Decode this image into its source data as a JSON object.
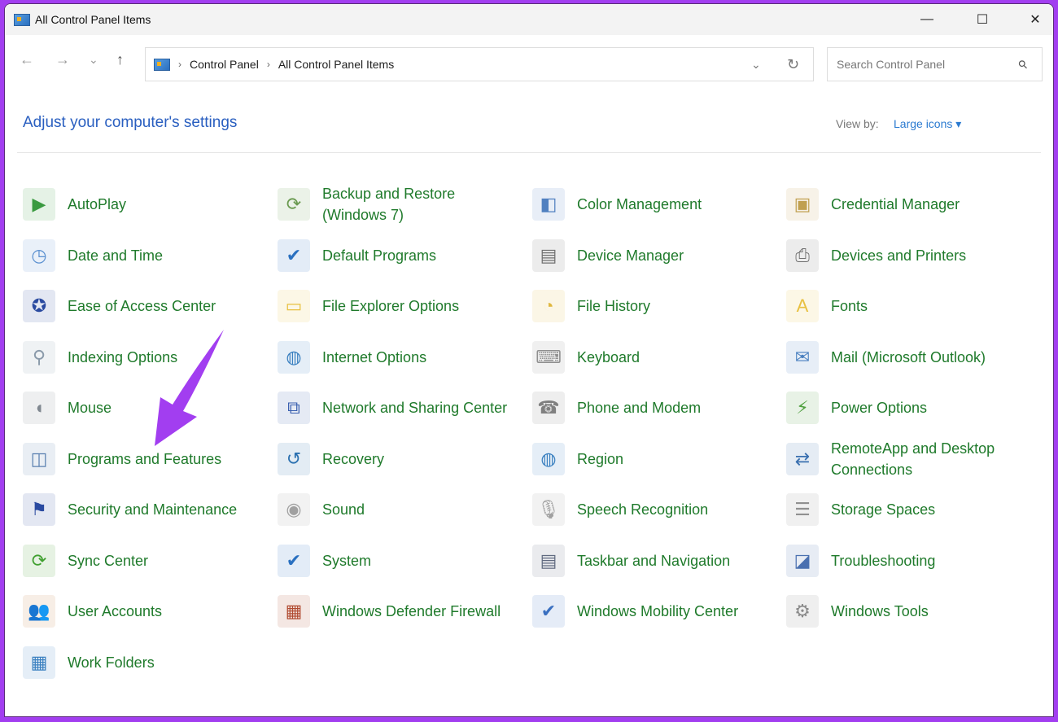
{
  "window": {
    "title": "All Control Panel Items",
    "minimize": "—",
    "maximize": "☐",
    "close": "✕"
  },
  "nav": {
    "back": "←",
    "forward": "→",
    "recent": "⌄",
    "up": "↑"
  },
  "address": {
    "crumbs": [
      "Control Panel",
      "All Control Panel Items"
    ],
    "separator": "›",
    "dropdown": "⌄",
    "refresh": "↻"
  },
  "search": {
    "placeholder": "Search Control Panel",
    "icon": "⚲"
  },
  "heading": "Adjust your computer's settings",
  "view_by": {
    "label": "View by:",
    "value": "Large icons ▾"
  },
  "accent": {
    "link": "#1f7a2b",
    "heading": "#2a5fc0",
    "annotation_arrow": "#a23ef0"
  },
  "items": [
    {
      "label": "AutoPlay",
      "icon": "autoplay-icon",
      "g": "▶",
      "c": "#3a9a40"
    },
    {
      "label": "Backup and Restore (Windows 7)",
      "icon": "backup-icon",
      "g": "⟳",
      "c": "#6a9a50"
    },
    {
      "label": "Color Management",
      "icon": "color-management-icon",
      "g": "◧",
      "c": "#5080c0"
    },
    {
      "label": "Credential Manager",
      "icon": "credential-icon",
      "g": "▣",
      "c": "#c0a050"
    },
    {
      "label": "Date and Time",
      "icon": "clock-icon",
      "g": "◷",
      "c": "#5a90d0"
    },
    {
      "label": "Default Programs",
      "icon": "default-programs-icon",
      "g": "✔",
      "c": "#2a70c0"
    },
    {
      "label": "Device Manager",
      "icon": "device-manager-icon",
      "g": "▤",
      "c": "#707070"
    },
    {
      "label": "Devices and Printers",
      "icon": "printer-icon",
      "g": "⎙",
      "c": "#707070"
    },
    {
      "label": "Ease of Access Center",
      "icon": "ease-of-access-icon",
      "g": "✪",
      "c": "#2a4aa0"
    },
    {
      "label": "File Explorer Options",
      "icon": "folder-options-icon",
      "g": "▭",
      "c": "#e8c040"
    },
    {
      "label": "File History",
      "icon": "file-history-icon",
      "g": "◔",
      "c": "#e0b840"
    },
    {
      "label": "Fonts",
      "icon": "fonts-icon",
      "g": "A",
      "c": "#e8c040"
    },
    {
      "label": "Indexing Options",
      "icon": "indexing-icon",
      "g": "⚲",
      "c": "#8a9aaa"
    },
    {
      "label": "Internet Options",
      "icon": "internet-icon",
      "g": "◍",
      "c": "#3a80c0"
    },
    {
      "label": "Keyboard",
      "icon": "keyboard-icon",
      "g": "⌨",
      "c": "#909090"
    },
    {
      "label": "Mail (Microsoft Outlook)",
      "icon": "mail-icon",
      "g": "✉",
      "c": "#4a80c0"
    },
    {
      "label": "Mouse",
      "icon": "mouse-icon",
      "g": "◖",
      "c": "#808890"
    },
    {
      "label": "Network and Sharing Center",
      "icon": "network-icon",
      "g": "⧉",
      "c": "#3a60b0"
    },
    {
      "label": "Phone and Modem",
      "icon": "phone-icon",
      "g": "☎",
      "c": "#808080"
    },
    {
      "label": "Power Options",
      "icon": "power-icon",
      "g": "⚡",
      "c": "#50a040"
    },
    {
      "label": "Programs and Features",
      "icon": "programs-icon",
      "g": "◫",
      "c": "#5a80b0"
    },
    {
      "label": "Recovery",
      "icon": "recovery-icon",
      "g": "↺",
      "c": "#2a70b0"
    },
    {
      "label": "Region",
      "icon": "region-icon",
      "g": "◍",
      "c": "#3a80c0"
    },
    {
      "label": "RemoteApp and Desktop Connections",
      "icon": "remoteapp-icon",
      "g": "⇄",
      "c": "#3a70b0"
    },
    {
      "label": "Security and Maintenance",
      "icon": "flag-icon",
      "g": "⚑",
      "c": "#2a4aa0"
    },
    {
      "label": "Sound",
      "icon": "speaker-icon",
      "g": "◉",
      "c": "#a0a0a0"
    },
    {
      "label": "Speech Recognition",
      "icon": "microphone-icon",
      "g": "🎙",
      "c": "#a0a0a0"
    },
    {
      "label": "Storage Spaces",
      "icon": "storage-icon",
      "g": "☰",
      "c": "#909090"
    },
    {
      "label": "Sync Center",
      "icon": "sync-icon",
      "g": "⟳",
      "c": "#40a030"
    },
    {
      "label": "System",
      "icon": "system-icon",
      "g": "✔",
      "c": "#2a70c0"
    },
    {
      "label": "Taskbar and Navigation",
      "icon": "taskbar-icon",
      "g": "▤",
      "c": "#606a80"
    },
    {
      "label": "Troubleshooting",
      "icon": "troubleshooting-icon",
      "g": "◪",
      "c": "#4a70b0"
    },
    {
      "label": "User Accounts",
      "icon": "users-icon",
      "g": "👥",
      "c": "#c08040"
    },
    {
      "label": "Windows Defender Firewall",
      "icon": "firewall-icon",
      "g": "▦",
      "c": "#b04a30"
    },
    {
      "label": "Windows Mobility Center",
      "icon": "mobility-icon",
      "g": "✔",
      "c": "#3a70c0"
    },
    {
      "label": "Windows Tools",
      "icon": "gear-icon",
      "g": "⚙",
      "c": "#8a8a8a"
    },
    {
      "label": "Work Folders",
      "icon": "work-folders-icon",
      "g": "▦",
      "c": "#3a80c0"
    }
  ]
}
